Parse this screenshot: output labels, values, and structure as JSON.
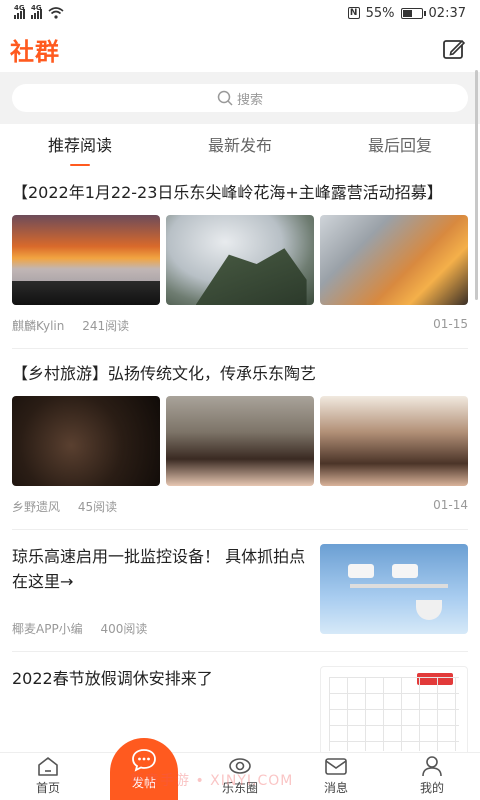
{
  "status_bar": {
    "signal1": "4G",
    "signal2": "4G",
    "battery": "55%",
    "battery_level": 0.55,
    "time": "02:37"
  },
  "header": {
    "title": "社群",
    "compose_icon": "compose-icon"
  },
  "search": {
    "placeholder": "搜索"
  },
  "tabs": [
    {
      "label": "推荐阅读",
      "active": true
    },
    {
      "label": "最新发布",
      "active": false
    },
    {
      "label": "最后回复",
      "active": false
    }
  ],
  "posts": [
    {
      "title": "【2022年1月22-23日乐东尖峰岭花海+主峰露营活动招募】",
      "author": "麒麟Kylin",
      "reads": "241阅读",
      "date": "01-15"
    },
    {
      "title": "【乡村旅游】弘扬传统文化，传承乐东陶艺",
      "author": "乡野遗风",
      "reads": "45阅读",
      "date": "01-14"
    },
    {
      "title": "琼乐高速启用一批监控设备！ 具体抓拍点在这里→",
      "author": "椰麦APP小编",
      "reads": "400阅读"
    },
    {
      "title": "2022春节放假调休安排来了"
    }
  ],
  "bottom_nav": {
    "home": "首页",
    "post": "发帖",
    "circle": "乐东圈",
    "messages": "消息",
    "me": "我的"
  },
  "watermark": "新意手游 • XINYI.COM",
  "colors": {
    "accent": "#ff5a1f",
    "muted": "#999999"
  }
}
